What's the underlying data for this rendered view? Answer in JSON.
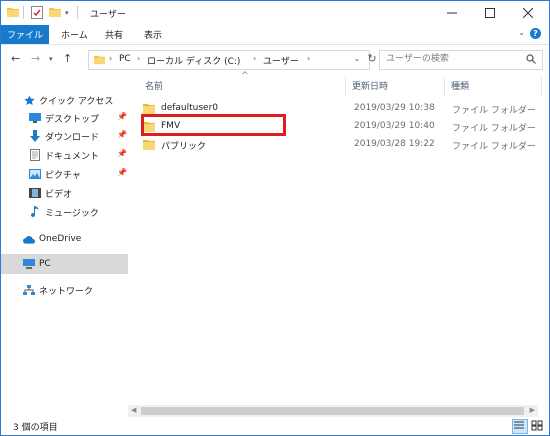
{
  "window": {
    "title": "ユーザー"
  },
  "ribbon": {
    "file_tab": "ファイル",
    "tabs": [
      "ホーム",
      "共有",
      "表示"
    ]
  },
  "address": {
    "segments": [
      "PC",
      "ローカル ディスク (C:)",
      "ユーザー"
    ]
  },
  "search": {
    "placeholder": "ユーザーの検索"
  },
  "sidebar": {
    "quick_access": "クイック アクセス",
    "items": [
      {
        "label": "デスクトップ",
        "icon": "desktop-icon",
        "pinned": true
      },
      {
        "label": "ダウンロード",
        "icon": "download-icon",
        "pinned": true
      },
      {
        "label": "ドキュメント",
        "icon": "documents-icon",
        "pinned": true
      },
      {
        "label": "ピクチャ",
        "icon": "pictures-icon",
        "pinned": true
      },
      {
        "label": "ビデオ",
        "icon": "videos-icon",
        "pinned": false
      },
      {
        "label": "ミュージック",
        "icon": "music-icon",
        "pinned": false
      }
    ],
    "onedrive": "OneDrive",
    "pc": "PC",
    "network": "ネットワーク"
  },
  "columns": {
    "name": "名前",
    "date": "更新日時",
    "type": "種類"
  },
  "files": [
    {
      "name": "defaultuser0",
      "date": "2019/03/29 10:38",
      "type": "ファイル フォルダー"
    },
    {
      "name": "FMV",
      "date": "2019/03/29 10:40",
      "type": "ファイル フォルダー"
    },
    {
      "name": "パブリック",
      "date": "2019/03/28 19:22",
      "type": "ファイル フォルダー"
    }
  ],
  "status": {
    "item_count": "3 個の項目"
  },
  "colors": {
    "accent": "#1979ca",
    "highlight_box": "#e01e1e",
    "folder": "#f5c242",
    "selected_nav": "#d9d9d9"
  }
}
